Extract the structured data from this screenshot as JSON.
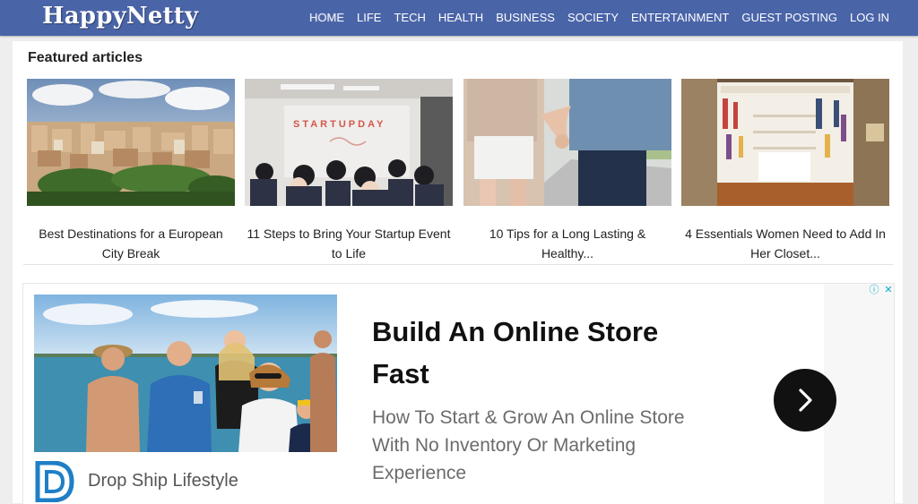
{
  "site": {
    "logo": "HappyNetty"
  },
  "nav": {
    "items": [
      {
        "label": "HOME",
        "active": true
      },
      {
        "label": "LIFE"
      },
      {
        "label": "TECH"
      },
      {
        "label": "HEALTH"
      },
      {
        "label": "BUSINESS"
      },
      {
        "label": "SOCIETY"
      },
      {
        "label": "ENTERTAINMENT"
      },
      {
        "label": "GUEST POSTING"
      },
      {
        "label": "LOG IN"
      }
    ]
  },
  "featured": {
    "heading": "Featured articles",
    "articles": [
      {
        "line1": "Best Destinations for a European",
        "line2": "City Break"
      },
      {
        "line1": "11 Steps to Bring Your Startup Event",
        "line2": "to Life",
        "image_text": "STARTUPDAY"
      },
      {
        "line1": "10 Tips for a Long Lasting &",
        "line2": "Healthy..."
      },
      {
        "line1": "4 Essentials Women Need to Add In",
        "line2": "Her Closet..."
      }
    ]
  },
  "ad": {
    "headline_line1": "Build An Online Store",
    "headline_line2": "Fast",
    "desc_line1": "How To Start & Grow An Online Store",
    "desc_line2": "With No Inventory Or Marketing",
    "desc_line3": "Experience",
    "brand": "Drop Ship Lifestyle",
    "cta_icon": "chevron-right-icon",
    "choices_info_icon": "ⓘ",
    "choices_close_icon": "✕"
  },
  "colors": {
    "header_bg": "#4a64a8",
    "accent": "#00aecd"
  }
}
